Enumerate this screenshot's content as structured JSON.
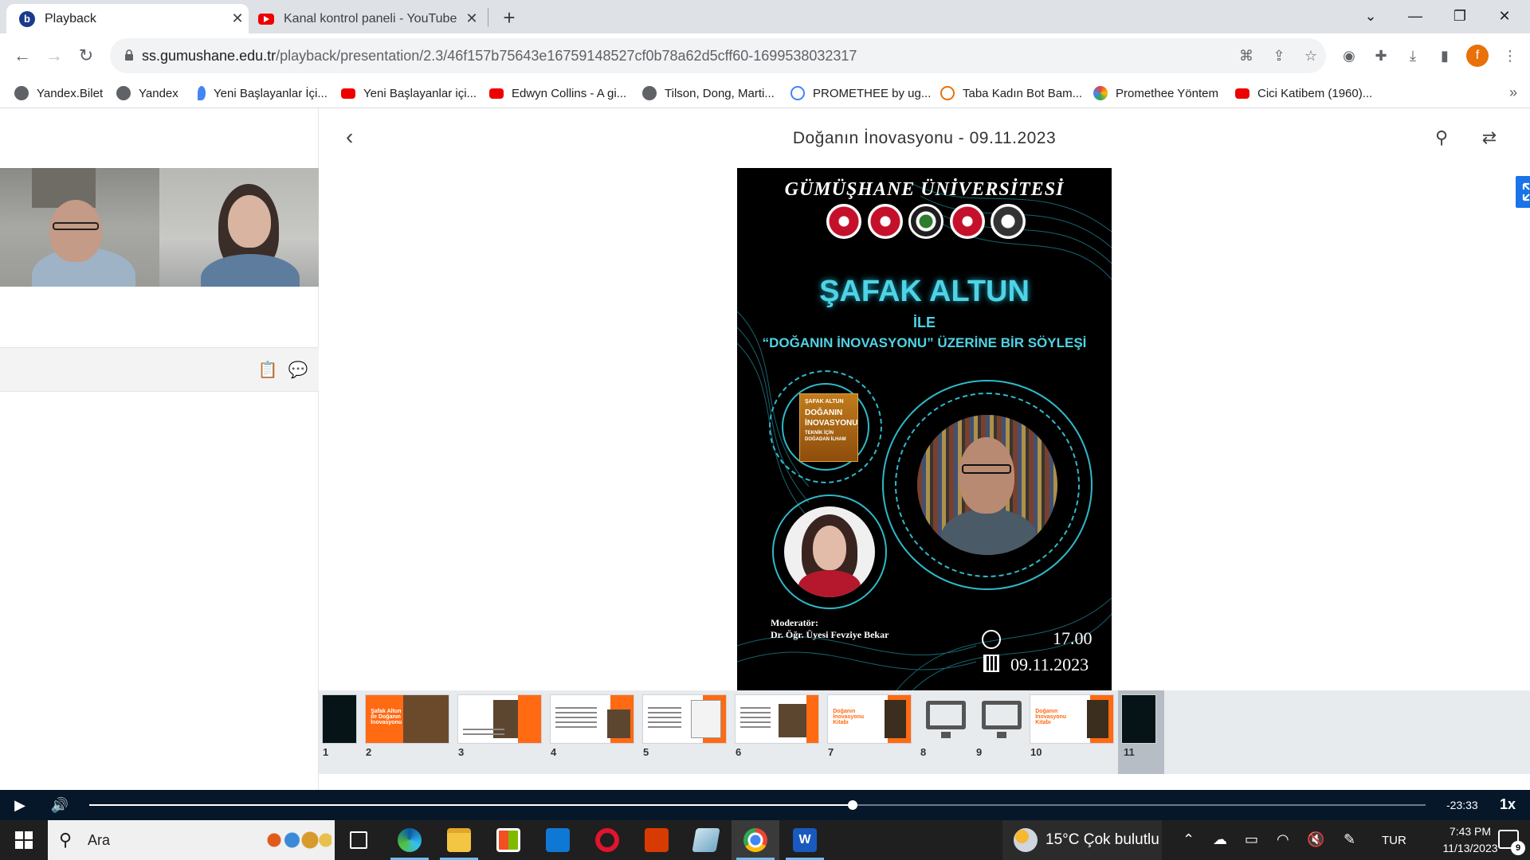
{
  "browser": {
    "tabs": [
      {
        "title": "Playback",
        "active": true
      },
      {
        "title": "Kanal kontrol paneli - YouTube Studio",
        "active": false
      }
    ],
    "url_host": "ss.gumushane.edu.tr",
    "url_path": "/playback/presentation/2.3/46f157b75643e16759148527cf0b78a62d5cff60-1699538032317",
    "profile_initial": "f",
    "bookmarks": [
      {
        "label": "Yandex.Bilet",
        "icon": "globe-icon"
      },
      {
        "label": "Yandex",
        "icon": "globe-icon"
      },
      {
        "label": "Yeni Başlayanlar İçi...",
        "icon": "drop-icon"
      },
      {
        "label": "Yeni Başlayanlar içi...",
        "icon": "youtube-icon"
      },
      {
        "label": "Edwyn Collins - A gi...",
        "icon": "youtube-icon"
      },
      {
        "label": "Tilson, Dong, Marti...",
        "icon": "globe-icon"
      },
      {
        "label": "PROMETHEE by ug...",
        "icon": "ring-icon"
      },
      {
        "label": "Taba Kadın Bot Bam...",
        "icon": "orange-ring-icon"
      },
      {
        "label": "Promethee Yöntem",
        "icon": "multicolor-icon"
      },
      {
        "label": "Cici Katibem (1960)...",
        "icon": "youtube-icon"
      }
    ]
  },
  "presentation": {
    "title": "Doğanın İnovasyonu - 09.11.2023"
  },
  "slide": {
    "university": "GÜMÜŞHANE ÜNİVERSİTESİ",
    "speaker": "ŞAFAK ALTUN",
    "with": "İLE",
    "subtitle": "“DOĞANIN İNOVASYONU”  ÜZERİNE BİR SÖYLEŞİ",
    "book_lines": [
      "ŞAFAK ALTUN",
      "DOĞANIN",
      "İNOVASYONU",
      "TEKNİK İÇİN",
      "DOĞADAN İLHAM"
    ],
    "moderator_label": "Moderatör:",
    "moderator_name": "Dr. Öğr. Üyesi Fevziye Bekar",
    "time": "17.00",
    "date": "09.11.2023"
  },
  "thumbnails": [
    {
      "num": "1",
      "style": "dark"
    },
    {
      "num": "2",
      "style": "orange",
      "label": "Şafak Altun ile Doğanın İnovasyonu"
    },
    {
      "num": "3",
      "style": "orange-photo"
    },
    {
      "num": "4",
      "style": "orange-photo"
    },
    {
      "num": "5",
      "style": "orange-book"
    },
    {
      "num": "6",
      "style": "orange-photo"
    },
    {
      "num": "7",
      "style": "orange-book",
      "label": "Doğanın İnovasyonu Kitabı"
    },
    {
      "num": "8",
      "style": "screen"
    },
    {
      "num": "9",
      "style": "screen"
    },
    {
      "num": "10",
      "style": "orange-book",
      "label": "Doğanın İnovasyonu Kitabı"
    },
    {
      "num": "11",
      "style": "dark",
      "selected": true
    }
  ],
  "player": {
    "remaining": "-23:33",
    "speed": "1x",
    "progress": 0.571
  },
  "taskbar": {
    "search_placeholder": "Ara",
    "weather": "15°C  Çok bulutlu",
    "language": "TUR",
    "time": "7:43 PM",
    "date": "11/13/2023",
    "notifications": "9"
  },
  "colors": {
    "accent": "#1a73e8",
    "poster_cyan": "#4fd3e6",
    "thumb_orange": "#ff6a13",
    "player_bg": "#06172a"
  }
}
